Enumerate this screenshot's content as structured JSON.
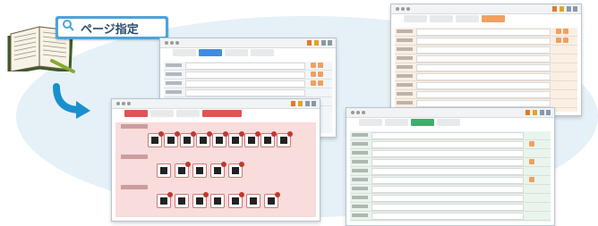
{
  "search_tag": {
    "label": "ページ指定"
  },
  "colors": {
    "background_ellipse": "#e6f0f7",
    "search_tag_blue": "#4ba3dc",
    "arrow_blue": "#1a8fce",
    "win_blue_accent": "#3d8ee0",
    "win_orange_accent": "#f0a060",
    "win_pink_accent": "#e05454",
    "win_green_accent": "#3fae6a"
  },
  "icons": [
    "search-icon",
    "book-icon",
    "magnifier-icon",
    "curved-arrow-icon"
  ],
  "windows": [
    {
      "id": "blue",
      "theme": "blue"
    },
    {
      "id": "orange",
      "theme": "orange"
    },
    {
      "id": "pink",
      "theme": "pink"
    },
    {
      "id": "green",
      "theme": "green"
    }
  ]
}
